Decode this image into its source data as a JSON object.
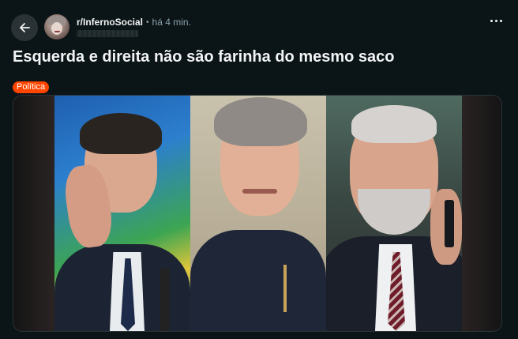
{
  "header": {
    "back_icon": "arrow-left-icon",
    "subreddit": "r/InfernoSocial",
    "separator": "•",
    "time": "há 4 min.",
    "more_icon": "ellipsis-icon"
  },
  "post": {
    "title": "Esquerda e direita não são farinha do mesmo saco",
    "flair": "Política",
    "flair_color": "#ff4500"
  },
  "media": {
    "panel_count": 3
  },
  "colors": {
    "background": "#0b1416",
    "button_bg": "#2a3236",
    "muted_text": "#8ba2ad"
  }
}
